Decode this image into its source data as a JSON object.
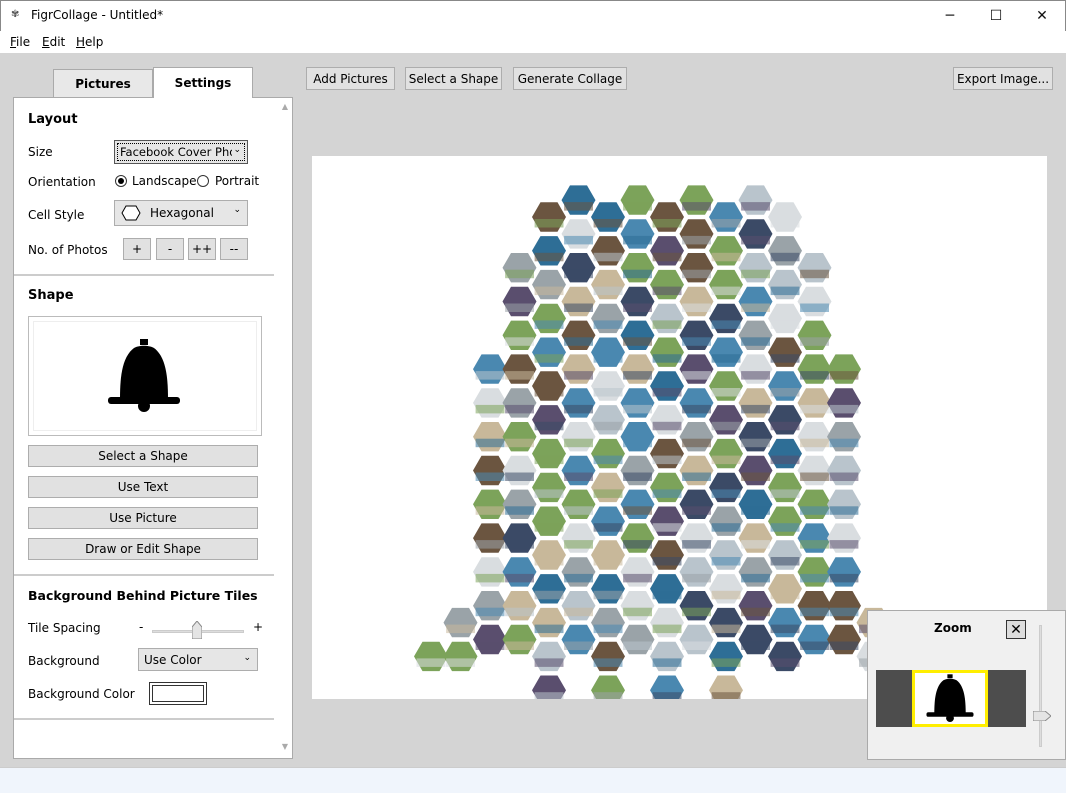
{
  "window": {
    "title": "FigrCollage - Untitled*",
    "min_glyph": "─",
    "max_glyph": "☐",
    "close_glyph": "✕"
  },
  "menu": [
    {
      "acc": "F",
      "rest": "ile"
    },
    {
      "acc": "E",
      "rest": "dit"
    },
    {
      "acc": "H",
      "rest": "elp"
    }
  ],
  "tabs": {
    "pictures": "Pictures",
    "settings": "Settings"
  },
  "toolbar": {
    "add_pictures": "Add Pictures",
    "select_shape": "Select a Shape",
    "generate": "Generate Collage",
    "export": "Export Image..."
  },
  "layout": {
    "title": "Layout",
    "size_label": "Size",
    "size_value": "Facebook Cover Pho",
    "orientation_label": "Orientation",
    "landscape": "Landscape",
    "portrait": "Portrait",
    "orientation_selected": "Landscape",
    "cell_style_label": "Cell Style",
    "cell_style_value": "Hexagonal",
    "photos_label": "No. of Photos",
    "photo_buttons": [
      "+",
      "-",
      "++",
      "--"
    ]
  },
  "shape": {
    "title": "Shape",
    "icon": "bell-icon",
    "select_shape": "Select a Shape",
    "use_text": "Use Text",
    "use_picture": "Use Picture",
    "draw_edit": "Draw or Edit Shape"
  },
  "background": {
    "title": "Background Behind Picture Tiles",
    "tile_spacing_label": "Tile Spacing",
    "minus": "-",
    "plus": "+",
    "tile_spacing_fraction": 0.45,
    "background_label": "Background",
    "background_value": "Use Color",
    "background_color_label": "Background Color",
    "background_color": "#ffffff"
  },
  "zoom": {
    "title": "Zoom",
    "close": "✕",
    "level_fraction": 0.2
  },
  "colors": {
    "canvas_bg": "#d4d4d4",
    "tile_palette": [
      "#4a88b0",
      "#9aa3a8",
      "#c8b89a",
      "#3b4a66",
      "#7ca35a",
      "#d9dde0",
      "#6b5540",
      "#2e6e96",
      "#b9c4cc",
      "#5a4e6e"
    ]
  }
}
